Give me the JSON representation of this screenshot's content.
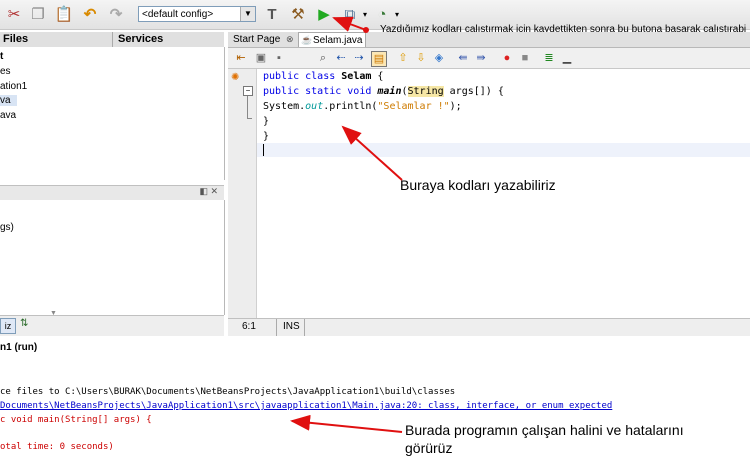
{
  "toolbar": {
    "config_value": "<default config>",
    "icons": [
      "cut-icon",
      "copy-icon",
      "paste-icon",
      "undo-icon",
      "redo-icon",
      "build-icon",
      "clean-build-icon",
      "run-icon",
      "debug-icon",
      "profile-icon"
    ]
  },
  "left": {
    "tab_files": "Files",
    "tab_services": "Services",
    "tree": [
      "t",
      "es",
      "ation1",
      "va",
      "ava"
    ],
    "nav_item": "gs)",
    "bottom_label": "iz"
  },
  "editor": {
    "tab_start": "Start Page",
    "tab_start_close": "⊗",
    "tab_file": "Selam.java",
    "code": {
      "l1_kw": "public class ",
      "l1_name": "Selam",
      "l1_rest": " {",
      "l2_kw": "public static void ",
      "l2_method": "main",
      "l2_paren": "(",
      "l2_type": "String",
      "l2_rest": " args[]) {",
      "l3_a": "System.",
      "l3_field": "out",
      "l3_b": ".println(",
      "l3_str": "\"Selamlar !\"",
      "l3_c": ");",
      "l4": "}",
      "l5": "}"
    },
    "status_pos": "6:1",
    "status_mode": "INS"
  },
  "output": {
    "title": "n1 (run)",
    "lines": [
      "ce files to C:\\Users\\BURAK\\Documents\\NetBeansProjects\\JavaApplication1\\build\\classes",
      "Documents\\NetBeansProjects\\JavaApplication1\\src\\javaapplication1\\Main.java:20: class, interface, or enum expected",
      "c void main(String[] args) {",
      "otal time: 0 seconds)"
    ]
  },
  "annotations": {
    "run_note": "Yazdığımız kodları çalıştırmak için kaydettikten sonra bu butona basarak çalıştırabi",
    "code_note": "Buraya kodları yazabiliriz",
    "output_note_1": "Burada programın çalışan halini ve hatalarını",
    "output_note_2": "görürüz"
  },
  "colors": {
    "keyword": "#0000e6",
    "string": "#ce7b00",
    "error": "#cc0000",
    "link": "#0000cc",
    "arrow": "#e01010"
  }
}
